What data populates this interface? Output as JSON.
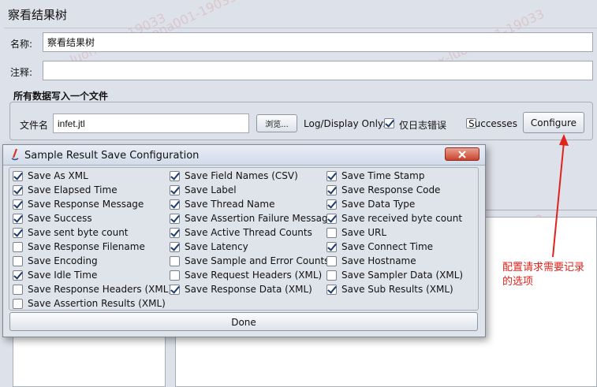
{
  "page": {
    "title": "察看结果树"
  },
  "form": {
    "name_label": "名称:",
    "name_value": "察看结果树",
    "comment_label": "注释:",
    "comment_value": ""
  },
  "file_section": {
    "title": "所有数据写入一个文件",
    "filename_label": "文件名",
    "filename_value": "infet.jtl",
    "browse_label": "浏览...",
    "log_display_label": "Log/Display Only:",
    "errors_only_label": "仅日志错误",
    "errors_only_checked": true,
    "successes_label": "Successes",
    "successes_checked": false,
    "configure_label": "Configure"
  },
  "dialog": {
    "title": "Sample Result Save Configuration",
    "done_label": "Done",
    "columns": [
      [
        {
          "label": "Save As XML",
          "checked": true
        },
        {
          "label": "Save Elapsed Time",
          "checked": true
        },
        {
          "label": "Save Response Message",
          "checked": true
        },
        {
          "label": "Save Success",
          "checked": true
        },
        {
          "label": "Save sent byte count",
          "checked": true
        },
        {
          "label": "Save Response Filename",
          "checked": false
        },
        {
          "label": "Save Encoding",
          "checked": false
        },
        {
          "label": "Save Idle Time",
          "checked": true
        },
        {
          "label": "Save Response Headers (XML)",
          "checked": false
        },
        {
          "label": "Save Assertion Results (XML)",
          "checked": false
        }
      ],
      [
        {
          "label": "Save Field Names (CSV)",
          "checked": true
        },
        {
          "label": "Save Label",
          "checked": true
        },
        {
          "label": "Save Thread Name",
          "checked": true
        },
        {
          "label": "Save Assertion Failure Message",
          "checked": true
        },
        {
          "label": "Save Active Thread Counts",
          "checked": true
        },
        {
          "label": "Save Latency",
          "checked": true
        },
        {
          "label": "Save Sample and Error Counts",
          "checked": false
        },
        {
          "label": "Save Request Headers (XML)",
          "checked": false
        },
        {
          "label": "Save Response Data (XML)",
          "checked": true
        }
      ],
      [
        {
          "label": "Save Time Stamp",
          "checked": true
        },
        {
          "label": "Save Response Code",
          "checked": true
        },
        {
          "label": "Save Data Type",
          "checked": true
        },
        {
          "label": "Save received byte count",
          "checked": true
        },
        {
          "label": "Save URL",
          "checked": false
        },
        {
          "label": "Save Connect Time",
          "checked": true
        },
        {
          "label": "Save Hostname",
          "checked": false
        },
        {
          "label": "Save Sampler Data (XML)",
          "checked": false
        },
        {
          "label": "Save Sub Results (XML)",
          "checked": true
        }
      ]
    ]
  },
  "annotation": {
    "text": "配置请求需要记录\n的选项",
    "color": "#e0231c"
  },
  "watermark": {
    "text": "ex-luona001-19033"
  },
  "colors": {
    "window_bg": "#dde1e9",
    "annotation_red": "#e0231c"
  }
}
